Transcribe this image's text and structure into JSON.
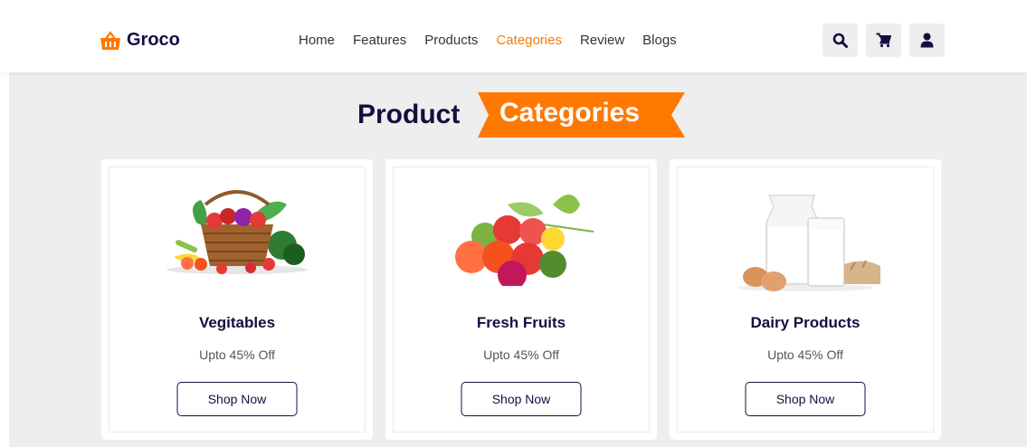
{
  "colors": {
    "accent": "#ff7800",
    "dark": "#130f40",
    "section_bg": "#eeeeee"
  },
  "brand": {
    "name": "Groco",
    "icon": "shopping-basket-icon"
  },
  "nav": [
    {
      "label": "Home",
      "active": false
    },
    {
      "label": "Features",
      "active": false
    },
    {
      "label": "Products",
      "active": false
    },
    {
      "label": "Categories",
      "active": true
    },
    {
      "label": "Review",
      "active": false
    },
    {
      "label": "Blogs",
      "active": false
    }
  ],
  "header_icons": [
    "search-icon",
    "cart-icon",
    "user-icon"
  ],
  "section": {
    "title_plain": "Product",
    "title_highlight": "Categories"
  },
  "cards": [
    {
      "title": "Vegitables",
      "subtitle": "Upto 45% Off",
      "button": "Shop Now",
      "image": "vegetable-basket-image"
    },
    {
      "title": "Fresh Fruits",
      "subtitle": "Upto 45% Off",
      "button": "Shop Now",
      "image": "fruits-image"
    },
    {
      "title": "Dairy Products",
      "subtitle": "Upto 45% Off",
      "button": "Shop Now",
      "image": "dairy-image"
    }
  ]
}
